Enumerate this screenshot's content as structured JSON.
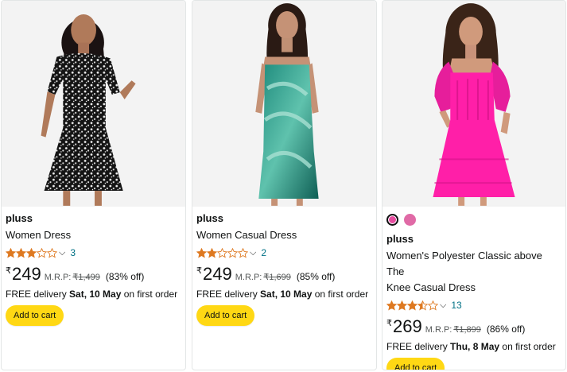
{
  "colors": {
    "card_border": "#e3e6e6",
    "star_fill": "#de7921",
    "link": "#007185",
    "button_bg": "#ffd814",
    "image_bg": "#f3f3f3"
  },
  "products": [
    {
      "brand": "pluss",
      "title_lines": [
        "Women Dress"
      ],
      "rating": 3,
      "rating_count": "3",
      "currency": "₹",
      "price": "249",
      "mrp_label": "M.R.P:",
      "mrp": "₹1,499",
      "discount": "(83% off)",
      "delivery_prefix": "FREE delivery",
      "delivery_date": "Sat, 10 May",
      "delivery_suffix": "on first order",
      "cart_label": "Add to cart",
      "image": "model-black-floral-dress"
    },
    {
      "brand": "pluss",
      "title_lines": [
        "Women Casual Dress"
      ],
      "rating": 2,
      "rating_count": "2",
      "currency": "₹",
      "price": "249",
      "mrp_label": "M.R.P:",
      "mrp": "₹1,699",
      "discount": "(85% off)",
      "delivery_prefix": "FREE delivery",
      "delivery_date": "Sat, 10 May",
      "delivery_suffix": "on first order",
      "cart_label": "Add to cart",
      "image": "model-green-mesh-dress"
    },
    {
      "brand": "pluss",
      "title_lines": [
        "Women's Polyester Classic above The",
        "Knee Casual Dress"
      ],
      "rating": 3.5,
      "rating_count": "13",
      "currency": "₹",
      "price": "269",
      "mrp_label": "M.R.P:",
      "mrp": "₹1,899",
      "discount": "(86% off)",
      "delivery_prefix": "FREE delivery",
      "delivery_date": "Thu, 8 May",
      "delivery_suffix": "on first order",
      "cart_label": "Add to cart",
      "image": "model-pink-dress",
      "swatches": [
        "#e64da0",
        "#e06aa6"
      ]
    }
  ]
}
